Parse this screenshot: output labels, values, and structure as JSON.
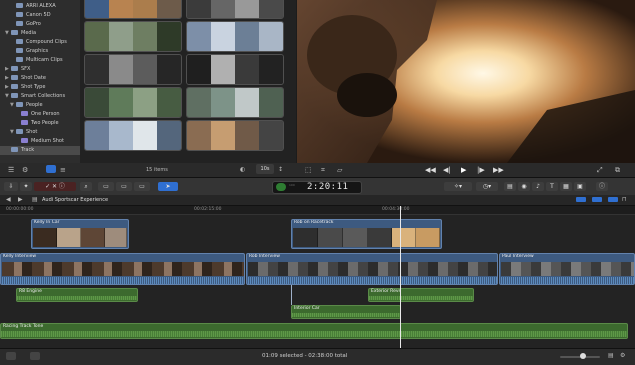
{
  "library": {
    "items": [
      {
        "label": "ARRI ALEXA",
        "indent": 2,
        "type": "folder",
        "expanded": null,
        "selected": false
      },
      {
        "label": "Canon 5D",
        "indent": 2,
        "type": "folder",
        "expanded": null,
        "selected": false
      },
      {
        "label": "GoPro",
        "indent": 2,
        "type": "folder",
        "expanded": null,
        "selected": false
      },
      {
        "label": "Media",
        "indent": 1,
        "type": "folder",
        "expanded": true,
        "selected": false
      },
      {
        "label": "Compound Clips",
        "indent": 2,
        "type": "folder",
        "expanded": null,
        "selected": false
      },
      {
        "label": "Graphics",
        "indent": 2,
        "type": "folder",
        "expanded": null,
        "selected": false
      },
      {
        "label": "Multicam Clips",
        "indent": 2,
        "type": "folder",
        "expanded": null,
        "selected": false
      },
      {
        "label": "SFX",
        "indent": 1,
        "type": "folder",
        "expanded": false,
        "selected": false
      },
      {
        "label": "Shot Date",
        "indent": 1,
        "type": "folder",
        "expanded": false,
        "selected": false
      },
      {
        "label": "Shot Type",
        "indent": 1,
        "type": "folder",
        "expanded": false,
        "selected": false
      },
      {
        "label": "Smart Collections",
        "indent": 1,
        "type": "folder",
        "expanded": true,
        "selected": false
      },
      {
        "label": "People",
        "indent": 2,
        "type": "folder",
        "expanded": true,
        "selected": false
      },
      {
        "label": "One Person",
        "indent": 3,
        "type": "smart",
        "expanded": null,
        "selected": false
      },
      {
        "label": "Two People",
        "indent": 3,
        "type": "smart",
        "expanded": null,
        "selected": false
      },
      {
        "label": "Shot",
        "indent": 2,
        "type": "folder",
        "expanded": true,
        "selected": false
      },
      {
        "label": "Medium Shot",
        "indent": 3,
        "type": "smart",
        "expanded": null,
        "selected": false
      },
      {
        "label": "Track",
        "indent": 1,
        "type": "event",
        "expanded": null,
        "selected": true
      }
    ]
  },
  "browser": {
    "item_count": "15 items",
    "duration": "10s",
    "thumbnails": [
      {
        "colors": [
          "#3f5e88",
          "#b88350",
          "#ab7d4c",
          "#6d5b4a"
        ]
      },
      {
        "colors": [
          "#3b3b3b",
          "#666",
          "#999",
          "#4a4a4a"
        ]
      },
      {
        "colors": [
          "#5a6a4c",
          "#8f9e8a",
          "#6e7e62",
          "#2e3a28"
        ]
      },
      {
        "colors": [
          "#7d8fa8",
          "#c9d3e0",
          "#6c7f96",
          "#a9b6c6"
        ]
      },
      {
        "colors": [
          "#2f2f2f",
          "#8a8a8a",
          "#5c5c5c",
          "#262626"
        ]
      },
      {
        "colors": [
          "#1f1f1f",
          "#b0b0b0",
          "#3a3a3a",
          "#222"
        ]
      },
      {
        "colors": [
          "#3a4a38",
          "#5f7b5a",
          "#8ca084",
          "#475c42"
        ]
      },
      {
        "colors": [
          "#5f6f62",
          "#7d9388",
          "#c0c8c8",
          "#4f6152"
        ]
      },
      {
        "colors": [
          "#6d7f9a",
          "#a8b8cc",
          "#e0e6ea",
          "#54667c"
        ]
      },
      {
        "colors": [
          "#8a6c52",
          "#c69d71",
          "#705a48",
          "#444"
        ]
      }
    ]
  },
  "toolbar": {
    "timecode": "2:20:11",
    "timecode_prefix": "HR MIN SEC FR",
    "timecode_percent": "100"
  },
  "timeline": {
    "project_name": "Audi Sportscar Experience",
    "ruler_ticks": [
      "00:00:00:00",
      "00:02:15:00",
      "00:04:30:00"
    ],
    "playhead_fraction": 0.63,
    "connected_clips": [
      {
        "label": "Kelly In Car"
      },
      {
        "label": "Rob on Racetrack"
      }
    ],
    "primary_clips": [
      {
        "label": "Kelly Interview"
      },
      {
        "label": "Rob Interview"
      },
      {
        "label": "Paul Interview"
      }
    ],
    "audio_clips": [
      {
        "label": "R8 Engine"
      },
      {
        "label": "Exterior Revs"
      },
      {
        "label": "Interior Car"
      },
      {
        "label": "Racing Track Tone"
      }
    ]
  },
  "status": {
    "selection_text": "01:09 selected - 02:38:00 total"
  },
  "colors": {
    "accent": "#2f6fd1",
    "video_clip": "#3d5a80",
    "audio_clip": "#3c6a2e",
    "timecode_green": "#3fc04d"
  }
}
